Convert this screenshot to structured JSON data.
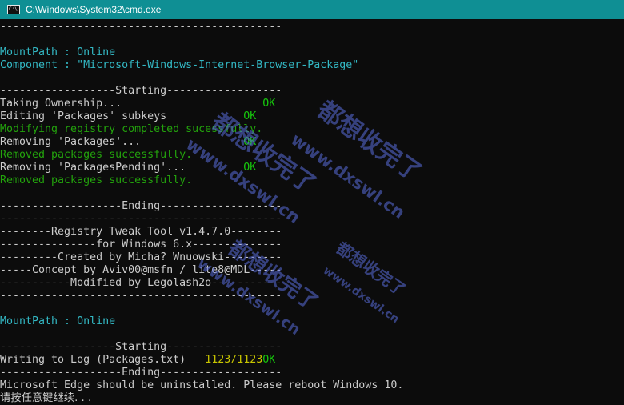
{
  "window": {
    "title": "C:\\Windows\\System32\\cmd.exe",
    "icon_label": "C:\\",
    "title_bar_color": "#0f8f94"
  },
  "console": {
    "lines": [
      {
        "text": "--------------------------------------------",
        "color": "#cccccc"
      },
      {
        "text": "",
        "color": "#cccccc"
      },
      {
        "text": "MountPath : Online",
        "color": "#33b8c4"
      },
      {
        "text": "Component : \"Microsoft-Windows-Internet-Browser-Package\"",
        "color": "#33b8c4"
      },
      {
        "text": "",
        "color": "#cccccc"
      },
      {
        "text": "------------------Starting------------------",
        "color": "#cccccc"
      },
      {
        "text": "Taking Ownership...",
        "status": "OK",
        "status_col": 41
      },
      {
        "text": "Editing 'Packages' subkeys",
        "status": "OK",
        "status_col": 38
      },
      {
        "text": "Modifying registry completed sucessfully.",
        "color": "#23a30c"
      },
      {
        "text": "Removing 'Packages'...",
        "status": "OK",
        "status_col": 38
      },
      {
        "text": "Removed packages successfully.",
        "color": "#23a30c"
      },
      {
        "text": "Removing 'PackagesPending'...",
        "status": "OK",
        "status_col": 38
      },
      {
        "text": "Removed packages successfully.",
        "color": "#23a30c"
      },
      {
        "text": "",
        "color": "#cccccc"
      },
      {
        "text": "-------------------Ending-------------------",
        "color": "#cccccc"
      },
      {
        "text": "--------------------------------------------",
        "color": "#cccccc"
      },
      {
        "text": "--------Registry Tweak Tool v1.4.7.0--------",
        "color": "#cccccc"
      },
      {
        "text": "---------------for Windows 6.x--------------",
        "color": "#cccccc"
      },
      {
        "text": "---------Created by Micha? Wnuowski---------",
        "color": "#cccccc"
      },
      {
        "text": "-----Concept by Aviv00@msfn / lite8@MDL-----",
        "color": "#cccccc"
      },
      {
        "text": "-----------Modified by Legolash2o-----------",
        "color": "#cccccc"
      },
      {
        "text": "--------------------------------------------",
        "color": "#cccccc"
      },
      {
        "text": "",
        "color": "#cccccc"
      },
      {
        "text": "MountPath : Online",
        "color": "#33b8c4"
      },
      {
        "text": "",
        "color": "#cccccc"
      },
      {
        "text": "------------------Starting------------------",
        "color": "#cccccc"
      },
      {
        "text": "Writing to Log (Packages.txt)",
        "count": "1123/1123",
        "count_col": 32,
        "status": "OK"
      },
      {
        "text": "-------------------Ending-------------------",
        "color": "#cccccc"
      },
      {
        "text": "Microsoft Edge should be uninstalled. Please reboot Windows 10.",
        "color": "#cccccc"
      },
      {
        "text": "请按任意键继续. . .",
        "color": "#cccccc",
        "cjk": true
      }
    ]
  },
  "watermark": {
    "texts": [
      "都想收完了",
      "www.dxswl.cn"
    ],
    "color": "#5a6edc"
  },
  "colors": {
    "background": "#0c0c0c",
    "default_text": "#cccccc",
    "cyan_text": "#33b8c4",
    "green_text": "#23a30c",
    "ok_text": "#16c60c",
    "yellow_text": "#c8c500"
  }
}
